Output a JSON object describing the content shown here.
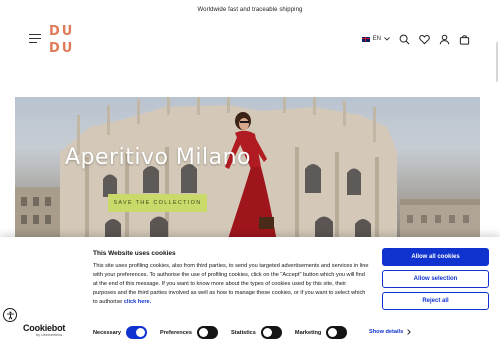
{
  "announcement": {
    "text": "Worldwide fast and traceable shipping"
  },
  "header": {
    "logo": {
      "top": "DU",
      "bottom": "DU"
    },
    "language": "EN",
    "icons": [
      "menu-icon",
      "flag-uk-icon",
      "chevron-down-icon",
      "search-icon",
      "heart-icon",
      "account-icon",
      "bag-icon"
    ]
  },
  "hero": {
    "title": "Aperitivo Milano",
    "cta_label": "SAVE THE COLLECTION",
    "cta_color": "#c9d96a"
  },
  "cookie_banner": {
    "title": "This Website uses cookies",
    "body": "This site uses profiling cookies, also from third parties, to send you targeted advertisements and services in line with your preferences. To authorise the use of profiling cookies, click on the \"Accept\" button which you will find at the end of this message. If you want to know more about the types of cookies used by this site, their purposes and the third parties involved as well as how to manage these cookies, or if you want to select which to authorise",
    "link_text": "click here.",
    "buttons": {
      "allow_all": "Allow all cookies",
      "allow_selection": "Allow selection",
      "reject_all": "Reject all"
    },
    "toggles": [
      {
        "label": "Necessary",
        "on": true
      },
      {
        "label": "Preferences",
        "on": false
      },
      {
        "label": "Statistics",
        "on": false
      },
      {
        "label": "Marketing",
        "on": false
      }
    ],
    "show_details": "Show details",
    "brand": {
      "name": "Cookiebot",
      "sub": "by Usercentrics"
    },
    "accent_color": "#1032cf"
  }
}
